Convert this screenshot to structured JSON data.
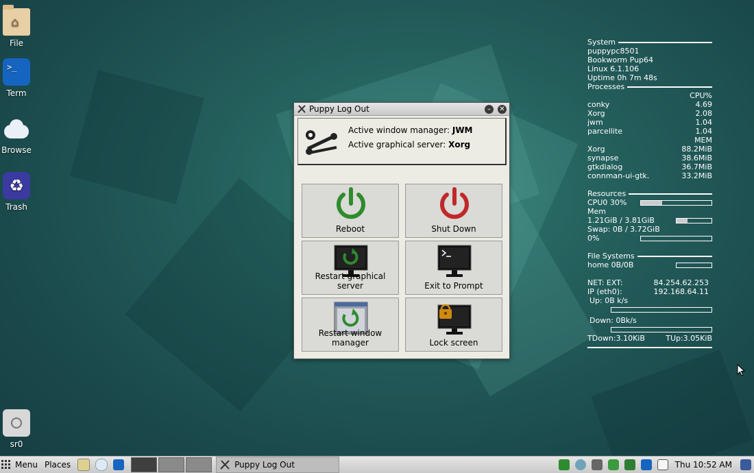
{
  "desktop_icons": [
    {
      "label": "File",
      "icon": "home-folder-icon"
    },
    {
      "label": "Term",
      "icon": "terminal-icon",
      "glyph": ">_"
    },
    {
      "label": "Browse",
      "icon": "cloud-icon"
    },
    {
      "label": "Trash",
      "icon": "recycle-icon",
      "glyph": "♻"
    },
    {
      "label": "sr0",
      "icon": "optical-drive-icon"
    }
  ],
  "conky": {
    "system_heading": "System",
    "hostname": "puppypc8501",
    "distro": "Bookworm Pup64",
    "kernel": "Linux 6.1.106",
    "uptime": "Uptime 0h 7m 48s",
    "processes_heading": "Processes",
    "cpu_header": "CPU%",
    "cpu_procs": [
      {
        "name": "conky",
        "value": "4.69"
      },
      {
        "name": "Xorg",
        "value": "2.08"
      },
      {
        "name": "jwm",
        "value": "1.04"
      },
      {
        "name": "parcellite",
        "value": "1.04"
      }
    ],
    "mem_header": "MEM",
    "mem_procs": [
      {
        "name": "Xorg",
        "value": "88.2MiB"
      },
      {
        "name": "synapse",
        "value": "38.6MiB"
      },
      {
        "name": "gtkdialog",
        "value": "36.7MiB"
      },
      {
        "name": "connman-ui-gtk.",
        "value": "33.2MiB"
      }
    ],
    "resources_heading": "Resources",
    "cpu0": "CPU0 30%",
    "cpu0_fraction": 0.3,
    "mem_label": "Mem",
    "mem_value": "1.21GiB / 3.81GiB",
    "mem_fraction": 0.32,
    "swap": "Swap: 0B / 3.72GiB",
    "swap_pct": "0%",
    "swap_fraction": 0,
    "fs_heading": "File Systems",
    "home": "home 0B/0B",
    "home_fraction": 0,
    "net_ext_label": "NET: EXT:",
    "net_ext_ip": "84.254.62.253",
    "ip_label": "IP (eth0):",
    "ip_value": "192.168.64.11",
    "up": "Up: 0B k/s",
    "down": "Down: 0Bk/s",
    "tdown": "TDown:3.10KiB",
    "tup": "TUp:3.05KiB"
  },
  "dialog": {
    "title": "Puppy Log Out",
    "wm_label": "Active window manager: ",
    "wm_value": "JWM",
    "server_label": "Active graphical server: ",
    "server_value": "Xorg",
    "buttons": {
      "reboot": "Reboot",
      "shutdown": "Shut Down",
      "restart_x": "Restart graphical server",
      "exit_prompt": "Exit to Prompt",
      "restart_wm": "Restart window manager",
      "lock": "Lock screen"
    }
  },
  "taskbar": {
    "menu": "Menu",
    "places": "Places",
    "task": "Puppy Log Out",
    "clock": "Thu 10:52 AM"
  },
  "colors": {
    "reboot_green": "#2e8b2e",
    "shutdown_red": "#c0282a",
    "lock_orange": "#d08a10"
  }
}
